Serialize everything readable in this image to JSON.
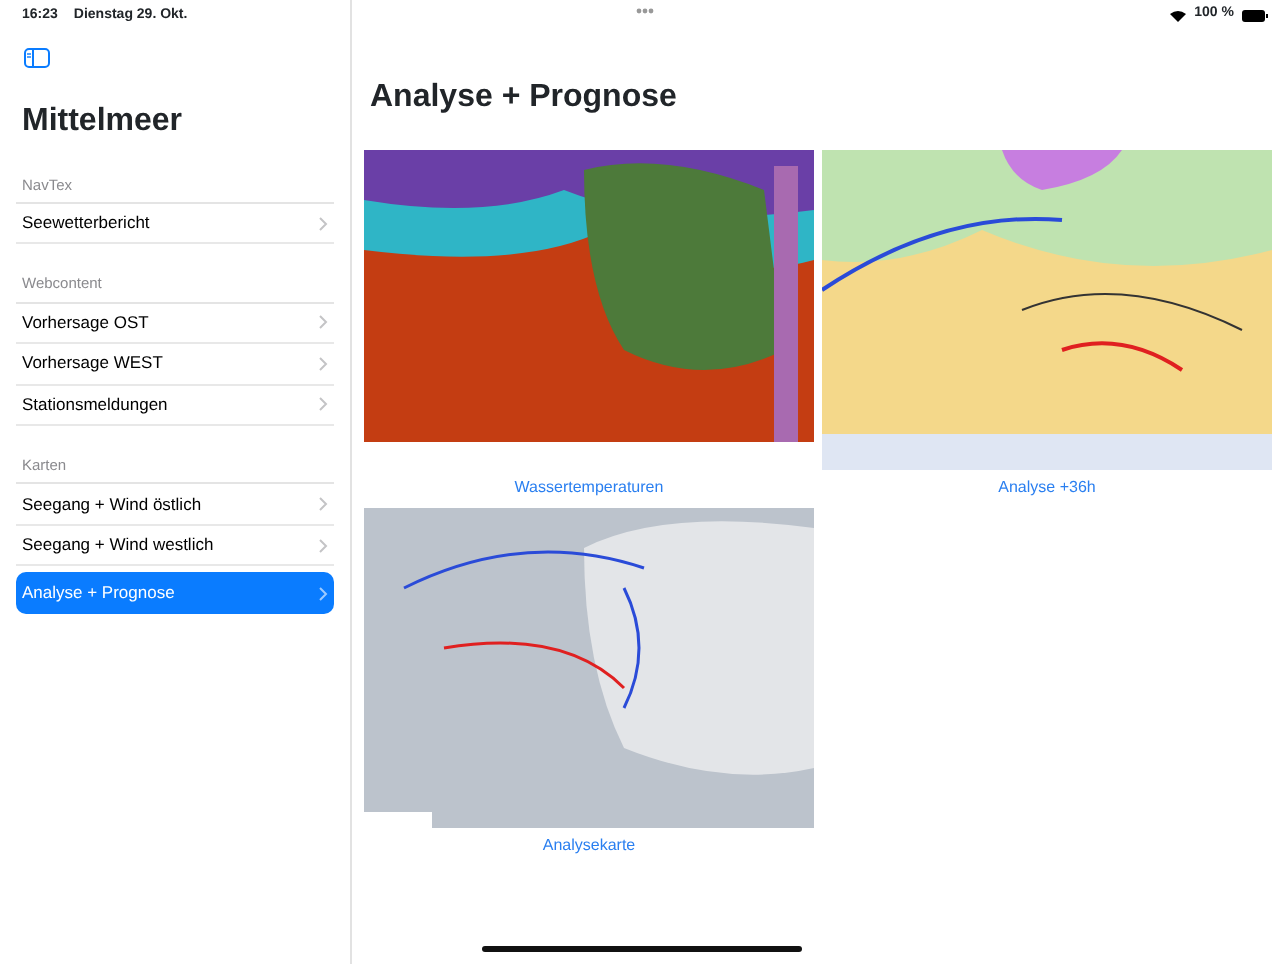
{
  "status_bar": {
    "time": "16:23",
    "date": "Dienstag 29. Okt.",
    "battery": "100 %"
  },
  "sidebar": {
    "title": "Mittelmeer",
    "sections": [
      {
        "header": "NavTex",
        "items": [
          {
            "label": "Seewetterbericht",
            "selected": false
          }
        ]
      },
      {
        "header": "Webcontent",
        "items": [
          {
            "label": "Vorhersage OST",
            "selected": false
          },
          {
            "label": "Vorhersage WEST",
            "selected": false
          },
          {
            "label": "Stationsmeldungen",
            "selected": false
          }
        ]
      },
      {
        "header": "Karten",
        "items": [
          {
            "label": "Seegang + Wind östlich",
            "selected": false
          },
          {
            "label": "Seegang + Wind westlich",
            "selected": false
          },
          {
            "label": "Analyse + Prognose",
            "selected": true
          }
        ]
      }
    ]
  },
  "main": {
    "title": "Analyse + Prognose",
    "maps": [
      {
        "kind": "temperature",
        "caption": "Wassertemperaturen"
      },
      {
        "kind": "forecast",
        "caption": "Analyse +36h"
      },
      {
        "kind": "analysis",
        "caption": "Analysekarte"
      }
    ]
  }
}
